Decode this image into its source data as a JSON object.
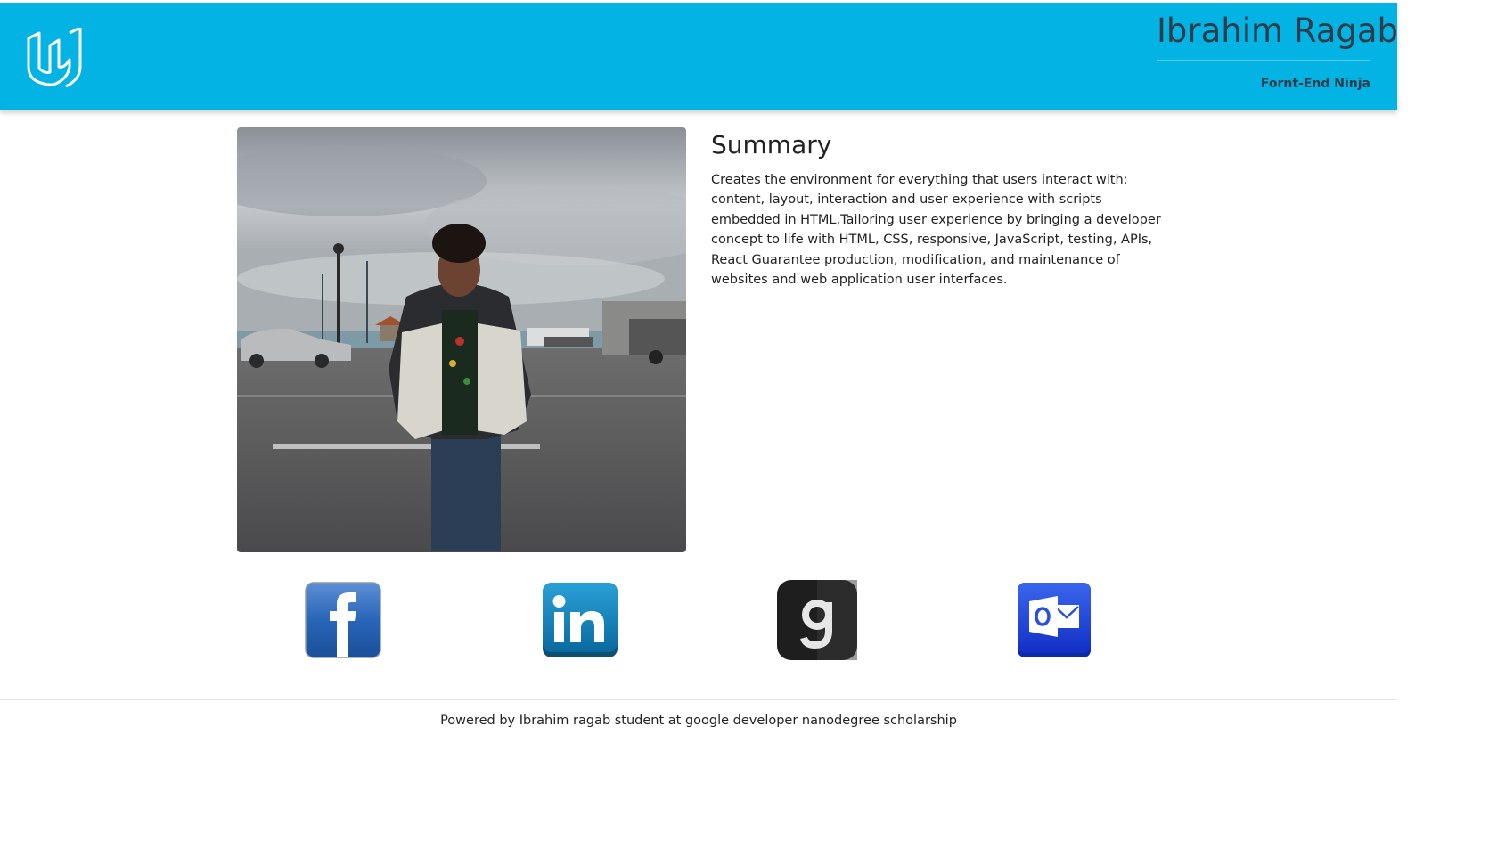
{
  "header": {
    "name": "Ibrahim Ragab",
    "subtitle": "Fornt-End Ninja",
    "logo_icon": "udacity-logo-icon",
    "background_color": "#02b3e4"
  },
  "profile": {
    "photo_icon": "profile-photo"
  },
  "summary": {
    "heading": "Summary",
    "text": "Creates the environment for everything that users interact with: content, layout, interaction and user experience with scripts embedded in HTML,Tailoring user experience by bringing a developer concept to life with HTML, CSS, responsive, JavaScript, testing, APIs, React Guarantee production, modification, and maintenance of websites and web application user interfaces."
  },
  "social_links": [
    {
      "icon": "facebook-icon",
      "color": "#3b5998"
    },
    {
      "icon": "linkedin-icon",
      "color": "#0077b5"
    },
    {
      "icon": "goodreads-icon",
      "color": "#222222"
    },
    {
      "icon": "outlook-icon",
      "color": "#1a3fd4"
    }
  ],
  "footer": {
    "text": "Powered by Ibrahim ragab student at google developer nanodegree scholarship"
  }
}
